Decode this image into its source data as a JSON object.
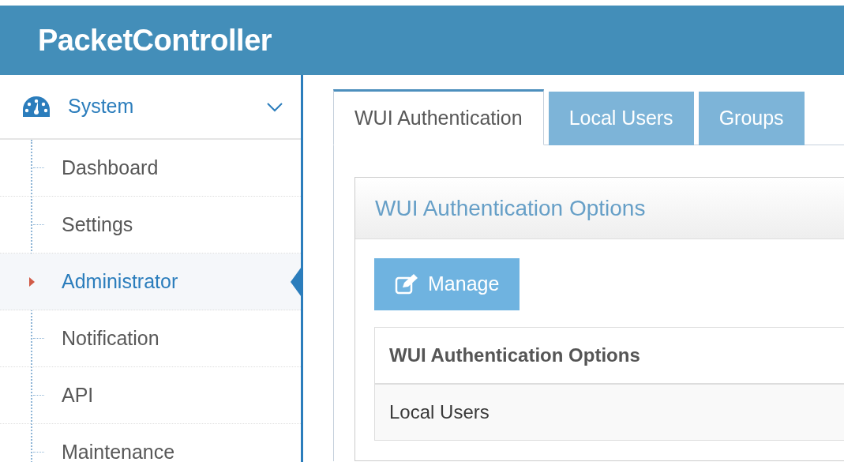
{
  "app": {
    "title": "PacketController"
  },
  "sidebar": {
    "section": {
      "label": "System",
      "expanded": true
    },
    "items": [
      {
        "label": "Dashboard",
        "selected": false
      },
      {
        "label": "Settings",
        "selected": false
      },
      {
        "label": "Administrator",
        "selected": true
      },
      {
        "label": "Notification",
        "selected": false
      },
      {
        "label": "API",
        "selected": false
      },
      {
        "label": "Maintenance",
        "selected": false
      }
    ]
  },
  "tabs": [
    {
      "label": "WUI Authentication",
      "selected": true
    },
    {
      "label": "Local Users",
      "selected": false
    },
    {
      "label": "Groups",
      "selected": false
    }
  ],
  "panel": {
    "title": "WUI Authentication Options",
    "button": "Manage",
    "table": {
      "header": "WUI Authentication Options",
      "rows": [
        "Local Users"
      ]
    }
  }
}
